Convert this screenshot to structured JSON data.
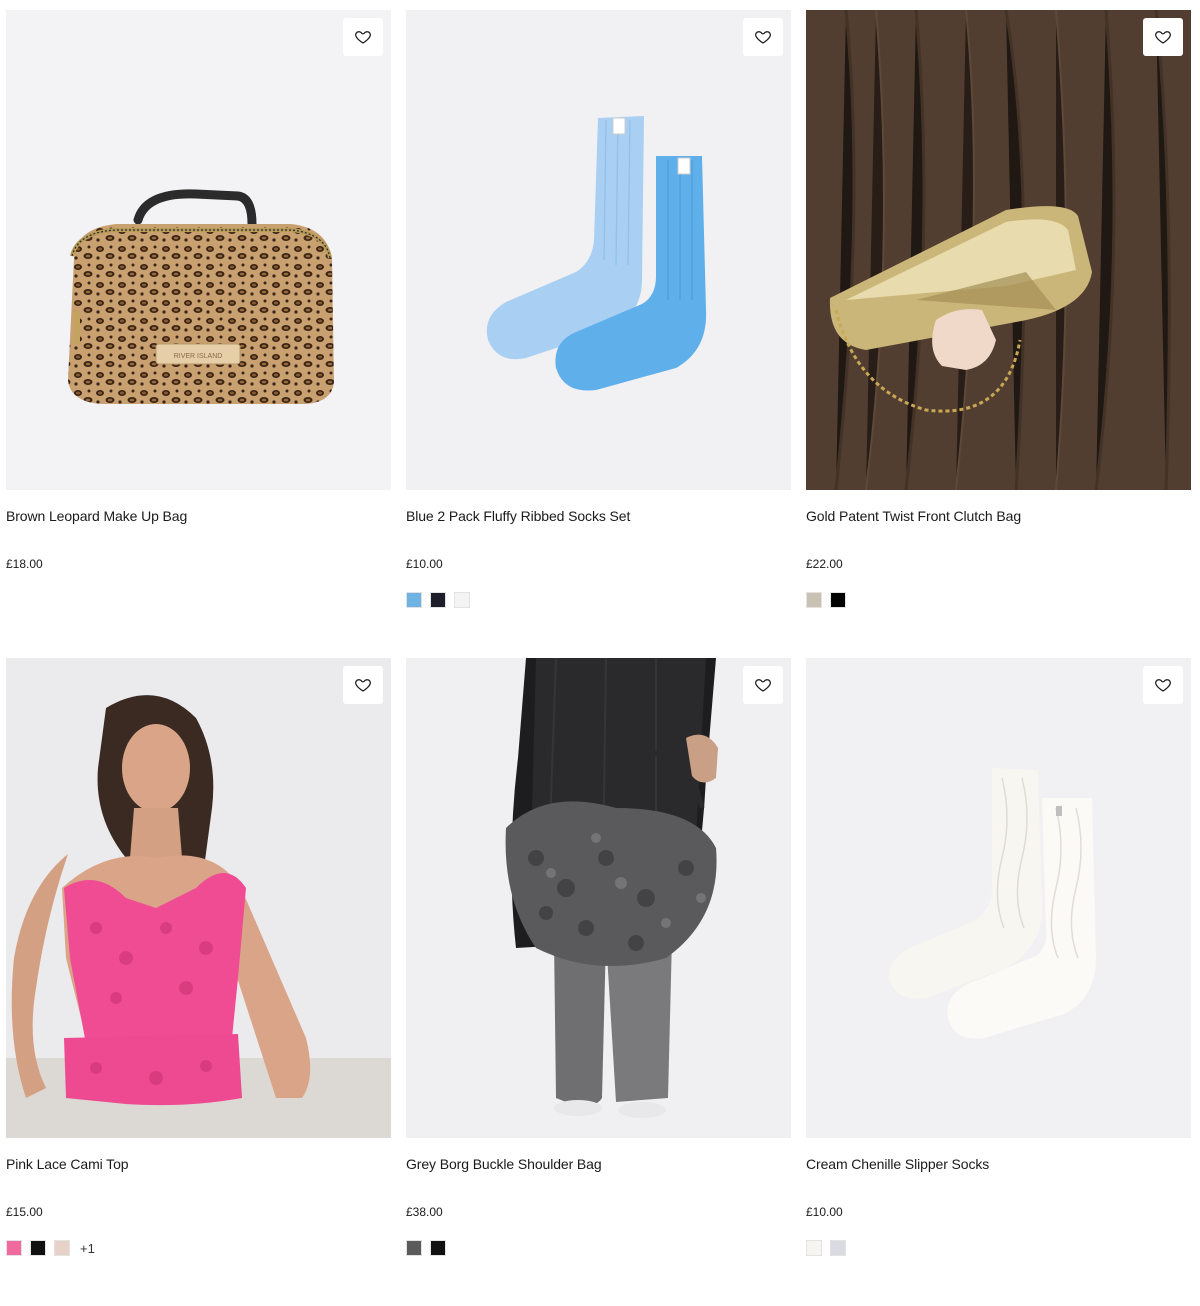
{
  "products": [
    {
      "name": "Brown Leopard Make Up Bag",
      "price": "£18.00",
      "image": "leopard-make-up-bag",
      "swatches": [],
      "more": ""
    },
    {
      "name": "Blue 2 Pack Fluffy Ribbed Socks Set",
      "price": "£10.00",
      "image": "blue-fluffy-socks",
      "swatches": [
        "#6fb2e4",
        "#1c1f2a",
        "#f4f4f4"
      ],
      "more": ""
    },
    {
      "name": "Gold Patent Twist Front Clutch Bag",
      "price": "£22.00",
      "image": "gold-clutch-bag",
      "swatches": [
        "#c9c2b2",
        "#000000"
      ],
      "more": ""
    },
    {
      "name": "Pink Lace Cami Top",
      "price": "£15.00",
      "image": "pink-lace-cami",
      "swatches": [
        "#f06aa0",
        "#111111",
        "#e6d2c8"
      ],
      "more": "+1"
    },
    {
      "name": "Grey Borg Buckle Shoulder Bag",
      "price": "£38.00",
      "image": "grey-borg-bag",
      "swatches": [
        "#5b5b5b",
        "#111111"
      ],
      "more": ""
    },
    {
      "name": "Cream Chenille Slipper Socks",
      "price": "£10.00",
      "image": "cream-slipper-socks",
      "swatches": [
        "#f6f5f0",
        "#d9dbe3"
      ],
      "more": ""
    }
  ],
  "icons": {
    "wishlist": "heart-outline-icon"
  }
}
